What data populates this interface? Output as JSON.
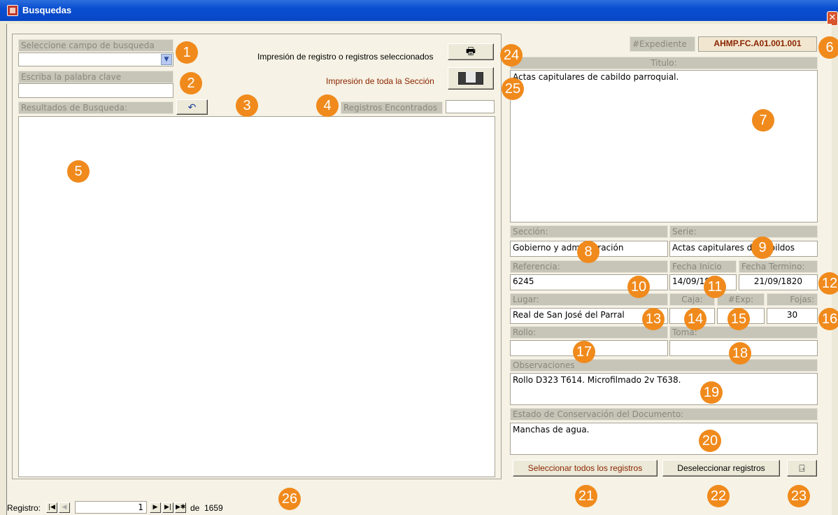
{
  "window": {
    "title": "Busquedas",
    "close_glyph": "✕"
  },
  "search": {
    "field_label": "Seleccione campo de busqueda",
    "field_value": "",
    "keyword_label": "Escriba la palabra clave",
    "keyword_value": "",
    "results_label": "Resultados de Busqueda:",
    "undo_glyph": "↶",
    "found_label": "Registros Encontrados",
    "found_value": ""
  },
  "print": {
    "selected_label": "Impresión de registro o registros seleccionados",
    "section_label": "Impresión de toda la Sección",
    "print_icon_glyph": "🖶"
  },
  "record": {
    "expediente_label": "#Expediente",
    "expediente_value": "AHMP.FC.A01.001.001",
    "titulo_label": "Titulo:",
    "titulo_value": "Actas capitulares de cabildo parroquial.",
    "seccion_label": "Sección:",
    "seccion_value": "Gobierno y administración",
    "serie_label": "Serie:",
    "serie_value": "Actas capitulares de cabildos",
    "referencia_label": "Referencia:",
    "referencia_value": "6245",
    "fecha_inicio_label": "Fecha Inicio",
    "fecha_inicio_value": "14/09/1820",
    "fecha_termino_label": "Fecha Termino:",
    "fecha_termino_value": "21/09/1820",
    "lugar_label": "Lugar:",
    "lugar_value": "Real de San José del Parral",
    "caja_label": "Caja:",
    "caja_value": "",
    "exp_label": "#Exp:",
    "exp_value": "",
    "fojas_label": "Fojas:",
    "fojas_value": "30",
    "rollo_label": "Rollo:",
    "rollo_value": "",
    "toma_label": "Toma:",
    "toma_value": "",
    "observaciones_label": "Observaciones",
    "observaciones_value": "Rollo D323 T614. Microfilmado 2v T638.",
    "estado_label": "Estado de Conservación del Documento:",
    "estado_value": "Manchas de agua."
  },
  "actions": {
    "select_all": "Seleccionar todos los registros",
    "deselect": "Deseleccionar registros",
    "exit_icon_glyph": "⍈"
  },
  "navigator": {
    "label": "Registro:",
    "current": "1",
    "of_label": "de",
    "total": "1659",
    "first_glyph": "|◀",
    "prev_glyph": "◀",
    "next_glyph": "▶",
    "last_glyph": "▶|",
    "new_glyph": "▶✱"
  },
  "badges": [
    "1",
    "2",
    "3",
    "4",
    "5",
    "6",
    "7",
    "8",
    "9",
    "10",
    "11",
    "12",
    "13",
    "14",
    "15",
    "16",
    "17",
    "18",
    "19",
    "20",
    "21",
    "22",
    "23",
    "24",
    "25",
    "26"
  ],
  "colors": {
    "badge": "#f08a1c",
    "titlebar": "#0a4fd1",
    "accent_text": "#8b2500"
  }
}
